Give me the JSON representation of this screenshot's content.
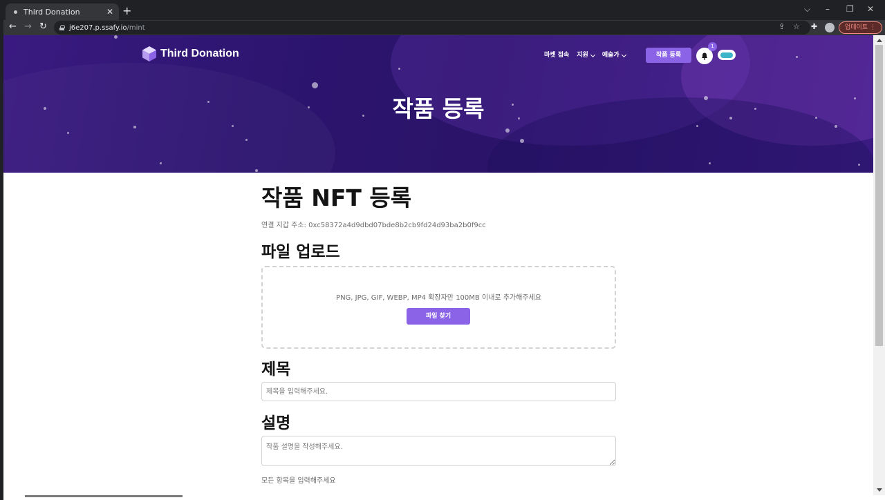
{
  "browser": {
    "tab_title": "Third Donation",
    "tab_close": "✕",
    "new_tab": "+",
    "url_host": "j6e207.p.ssafy.io",
    "url_path": "/mint",
    "update_label": "업데이트",
    "update_menu": "⋮"
  },
  "header": {
    "logo_text": "Third Donation",
    "nav": [
      {
        "label": "마켓 접속"
      },
      {
        "label": "지원"
      },
      {
        "label": "예술가"
      }
    ],
    "mint_button": "작품 등록",
    "notification_count": "1",
    "hero_title": "작품 등록"
  },
  "form": {
    "heading": "작품 NFT 등록",
    "wallet_label": "연결 지갑 주소: ",
    "wallet_address": "0xc58372a4d9dbd07bde8b2cb9fd24d93ba2b0f9cc",
    "upload_title": "파일 업로드",
    "upload_hint": "PNG, JPG, GIF, WEBP, MP4 확장자만 100MB 이내로 추가해주세요",
    "upload_button": "파일 찾기",
    "title_label": "제목",
    "title_placeholder": "제목을 입력해주세요.",
    "desc_label": "설명",
    "desc_placeholder": "작품 설명을 작성해주세요.",
    "required_note": "모든 항목을 입력해주세요"
  },
  "colors": {
    "accent": "#8a63e6",
    "hero_bg": "#2d1570"
  }
}
